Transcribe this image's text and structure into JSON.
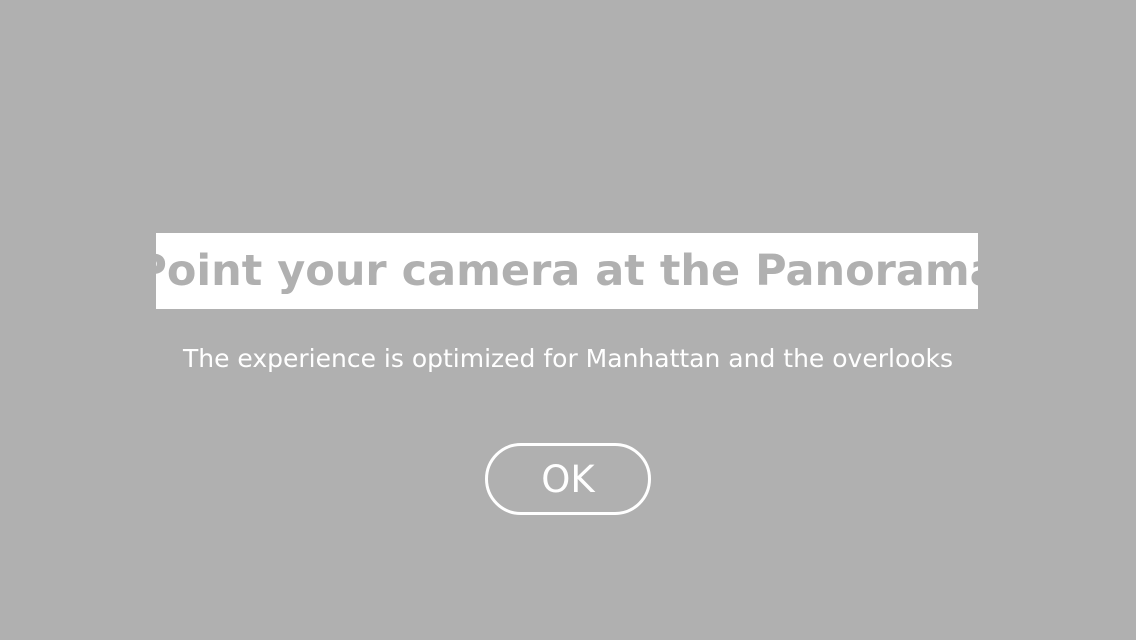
{
  "dialog": {
    "title": "Point your camera at the Panorama",
    "subtitle": "The experience is optimized for Manhattan and the overlooks",
    "ok_label": "OK"
  },
  "colors": {
    "background": "#b0b0b0",
    "title_box": "#ffffff",
    "title_text": "#b0b0b0",
    "text": "#ffffff"
  }
}
